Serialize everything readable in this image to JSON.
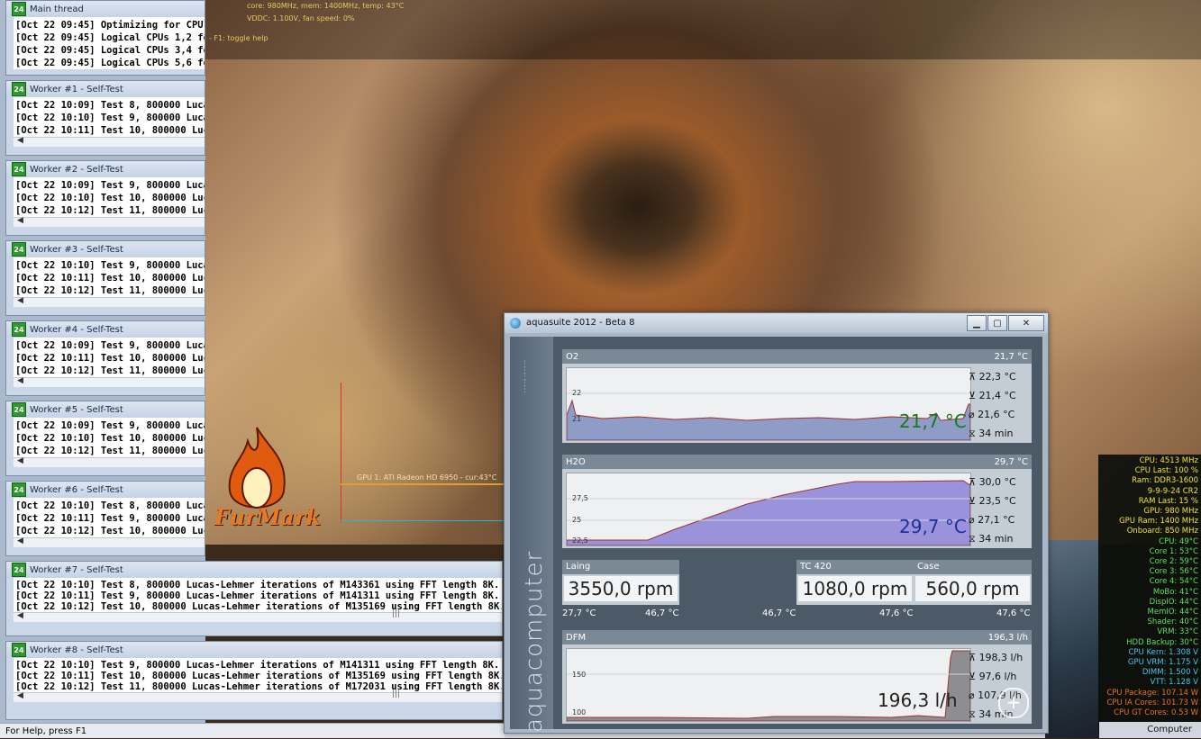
{
  "furmark": {
    "hud": [
      "core: 980MHz, mem: 1400MHz, temp: 43°C",
      "VDDC: 1.100V, fan speed: 0%",
      "- F1: toggle help"
    ],
    "gpu_label": "GPU 1: ATI Radeon HD 6950 - cur:43°C",
    "logo_text": "FurMark"
  },
  "prime": {
    "main": {
      "title": "Main thread",
      "lines": [
        "[Oct 22 09:45] Optimizing for CPU arc",
        "[Oct 22 09:45] Logical CPUs 1,2 form",
        "[Oct 22 09:45] Logical CPUs 3,4 form",
        "[Oct 22 09:45] Logical CPUs 5,6 form"
      ]
    },
    "workers": [
      {
        "title": "Worker #1 - Self-Test",
        "lines": [
          "[Oct 22 10:09] Test 8, 800000 Lucas-L",
          "[Oct 22 10:10] Test 9, 800000 Lucas-L",
          "[Oct 22 10:11] Test 10, 800000 Lucas"
        ]
      },
      {
        "title": "Worker #2 - Self-Test",
        "lines": [
          "[Oct 22 10:09] Test 9, 800000 Lucas-L",
          "[Oct 22 10:10] Test 10, 800000 Lucas",
          "[Oct 22 10:12] Test 11, 800000 Lucas"
        ]
      },
      {
        "title": "Worker #3 - Self-Test",
        "lines": [
          "[Oct 22 10:10] Test 9, 800000 Lucas-L",
          "[Oct 22 10:11] Test 10, 800000 Lucas",
          "[Oct 22 10:12] Test 11, 800000 Lucas"
        ]
      },
      {
        "title": "Worker #4 - Self-Test",
        "lines": [
          "[Oct 22 10:09] Test 9, 800000 Lucas-L",
          "[Oct 22 10:11] Test 10, 800000 Lucas",
          "[Oct 22 10:12] Test 11, 800000 Lucas"
        ]
      },
      {
        "title": "Worker #5 - Self-Test",
        "lines": [
          "[Oct 22 10:09] Test 9, 800000 Lucas-L",
          "[Oct 22 10:10] Test 10, 800000 Lucas",
          "[Oct 22 10:12] Test 11, 800000 Lucas"
        ]
      },
      {
        "title": "Worker #6 - Self-Test",
        "lines": [
          "[Oct 22 10:10] Test 8, 800000 Lucas-L",
          "[Oct 22 10:11] Test 9, 800000 Lucas-L",
          "[Oct 22 10:12] Test 10, 800000 Lucas"
        ]
      }
    ],
    "wide_workers": [
      {
        "title": "Worker #7 - Self-Test",
        "lines": [
          "[Oct 22 10:10] Test 8, 800000 Lucas-Lehmer iterations of M143361 using FFT length 8K.",
          "[Oct 22 10:11] Test 9, 800000 Lucas-Lehmer iterations of M141311 using FFT length 8K.",
          "[Oct 22 10:12] Test 10, 800000 Lucas-Lehmer iterations of M135169 using FFT length 8K."
        ]
      },
      {
        "title": "Worker #8 - Self-Test",
        "lines": [
          "[Oct 22 10:10] Test 9, 800000 Lucas-Lehmer iterations of M141311 using FFT length 8K.",
          "[Oct 22 10:11] Test 10, 800000 Lucas-Lehmer iterations of M135169 using FFT length 8K.",
          "[Oct 22 10:12] Test 11, 800000 Lucas-Lehmer iterations of M172031 using FFT length 8K."
        ]
      }
    ],
    "grip": "|||",
    "status": "For Help, press F1"
  },
  "aqua": {
    "title": "aquasuite 2012 - Beta 8",
    "brand": "aquacomputer",
    "o2": {
      "name": "O2",
      "value": "21,7 °C",
      "big": "21,7 °C",
      "max": "22,3 °C",
      "min": "21,4 °C",
      "avg": "21,6 °C",
      "dur": "34 min",
      "ticks": [
        "22",
        "21"
      ],
      "accent": "#1a7a1a"
    },
    "h2o": {
      "name": "H2O",
      "value": "29,7 °C",
      "big": "29,7 °C",
      "max": "30,0 °C",
      "min": "23,5 °C",
      "avg": "27,1 °C",
      "dur": "34 min",
      "ticks": [
        "27,5",
        "25",
        "22,5"
      ],
      "accent": "#1f2f9a"
    },
    "laing": {
      "name": "Laing",
      "value": "3550,0 rpm",
      "t1": "27,7 °C",
      "t2": "46,7 °C"
    },
    "tc420": {
      "name": "TC 420",
      "value": "1080,0 rpm",
      "t0": "46,7 °C",
      "t1": "47,6 °C"
    },
    "case": {
      "name": "Case",
      "value": "560,0 rpm",
      "t1": "47,6 °C"
    },
    "dfm": {
      "name": "DFM",
      "value": "196,3 l/h",
      "big": "196,3 l/h",
      "max": "198,3 l/h",
      "min": "97,6 l/h",
      "avg": "107,9 l/h",
      "dur": "34 min",
      "ticks": [
        "150",
        "100"
      ]
    }
  },
  "hw": {
    "lines": [
      {
        "t": "CPU: 4513 MHz",
        "c": "#f0e040"
      },
      {
        "t": "CPU Last: 100 %",
        "c": "#f0e040"
      },
      {
        "t": "Ram: DDR3-1600",
        "c": "#f0e040"
      },
      {
        "t": "9-9-9-24 CR2",
        "c": "#f0e040"
      },
      {
        "t": "RAM Last: 15 %",
        "c": "#f0e040"
      },
      {
        "t": "GPU: 980 MHz",
        "c": "#f0e040"
      },
      {
        "t": "GPU Ram: 1400 MHz",
        "c": "#f0e040"
      },
      {
        "t": "Onboard: 850 MHz",
        "c": "#f0e040"
      },
      {
        "t": "CPU: 49°C",
        "c": "#60e060"
      },
      {
        "t": "Core 1: 53°C",
        "c": "#60e060"
      },
      {
        "t": "Core 2: 59°C",
        "c": "#60e060"
      },
      {
        "t": "Core 3: 56°C",
        "c": "#60e060"
      },
      {
        "t": "Core 4: 54°C",
        "c": "#60e060"
      },
      {
        "t": "MoBo: 41°C",
        "c": "#60e060"
      },
      {
        "t": "DispIO: 44°C",
        "c": "#60e060"
      },
      {
        "t": "MemIO: 44°C",
        "c": "#60e060"
      },
      {
        "t": "Shader: 40°C",
        "c": "#60e060"
      },
      {
        "t": "VRM: 33°C",
        "c": "#60e060"
      },
      {
        "t": "HDD Backup: 30°C",
        "c": "#60e060"
      },
      {
        "t": "CPU Kern: 1.308 V",
        "c": "#40c8f0"
      },
      {
        "t": "GPU VRM: 1.175 V",
        "c": "#40c8f0"
      },
      {
        "t": "DIMM: 1.500 V",
        "c": "#40c8f0"
      },
      {
        "t": "VTT: 1.128 V",
        "c": "#40c8f0"
      },
      {
        "t": "CPU Package: 107.14 W",
        "c": "#f07020"
      },
      {
        "t": "CPU IA Cores: 101.73 W",
        "c": "#f07020"
      },
      {
        "t": "CPU GT Cores: 0.53 W",
        "c": "#f07020"
      }
    ],
    "computer": "Computer"
  }
}
